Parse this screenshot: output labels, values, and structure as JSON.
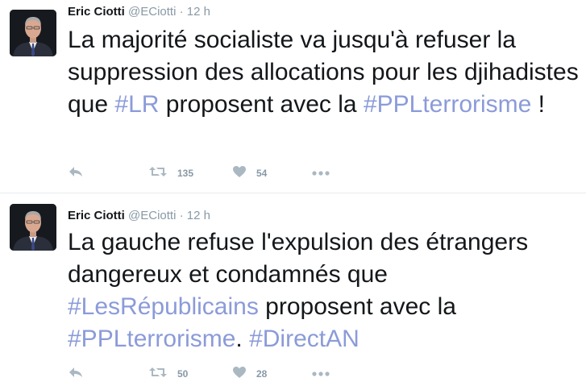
{
  "tweets": [
    {
      "name": "Eric Ciotti",
      "handle": "@ECiotti",
      "separator": "·",
      "time": "12 h",
      "text_parts": [
        {
          "text": "La majorité socialiste va jusqu'à refuser la suppression des allocations pour les djihadistes que "
        },
        {
          "text": "#LR"
        },
        {
          "text": " proposent avec la "
        },
        {
          "text": "#PPLterrorisme"
        },
        {
          "text": " !"
        }
      ],
      "retweets": "135",
      "likes": "54"
    },
    {
      "name": "Eric Ciotti",
      "handle": "@ECiotti",
      "separator": "·",
      "time": "12 h",
      "text_parts": [
        {
          "text": "La gauche refuse l'expulsion des étrangers dangereux et condamnés que "
        },
        {
          "text": "#LesRépublicains"
        },
        {
          "text": " proposent avec la "
        },
        {
          "text": "#PPLterrorisme"
        },
        {
          "text": ". "
        },
        {
          "text": "#DirectAN"
        }
      ],
      "retweets": "50",
      "likes": "28"
    }
  ],
  "icons": {
    "reply": "reply-icon",
    "retweet": "retweet-icon",
    "like": "heart-icon",
    "more": "more-icon"
  },
  "colors": {
    "hashtag": "#8b9bd9",
    "meta": "#8899a6",
    "divider": "#e6ecf0",
    "icon": "#aab8c2"
  }
}
